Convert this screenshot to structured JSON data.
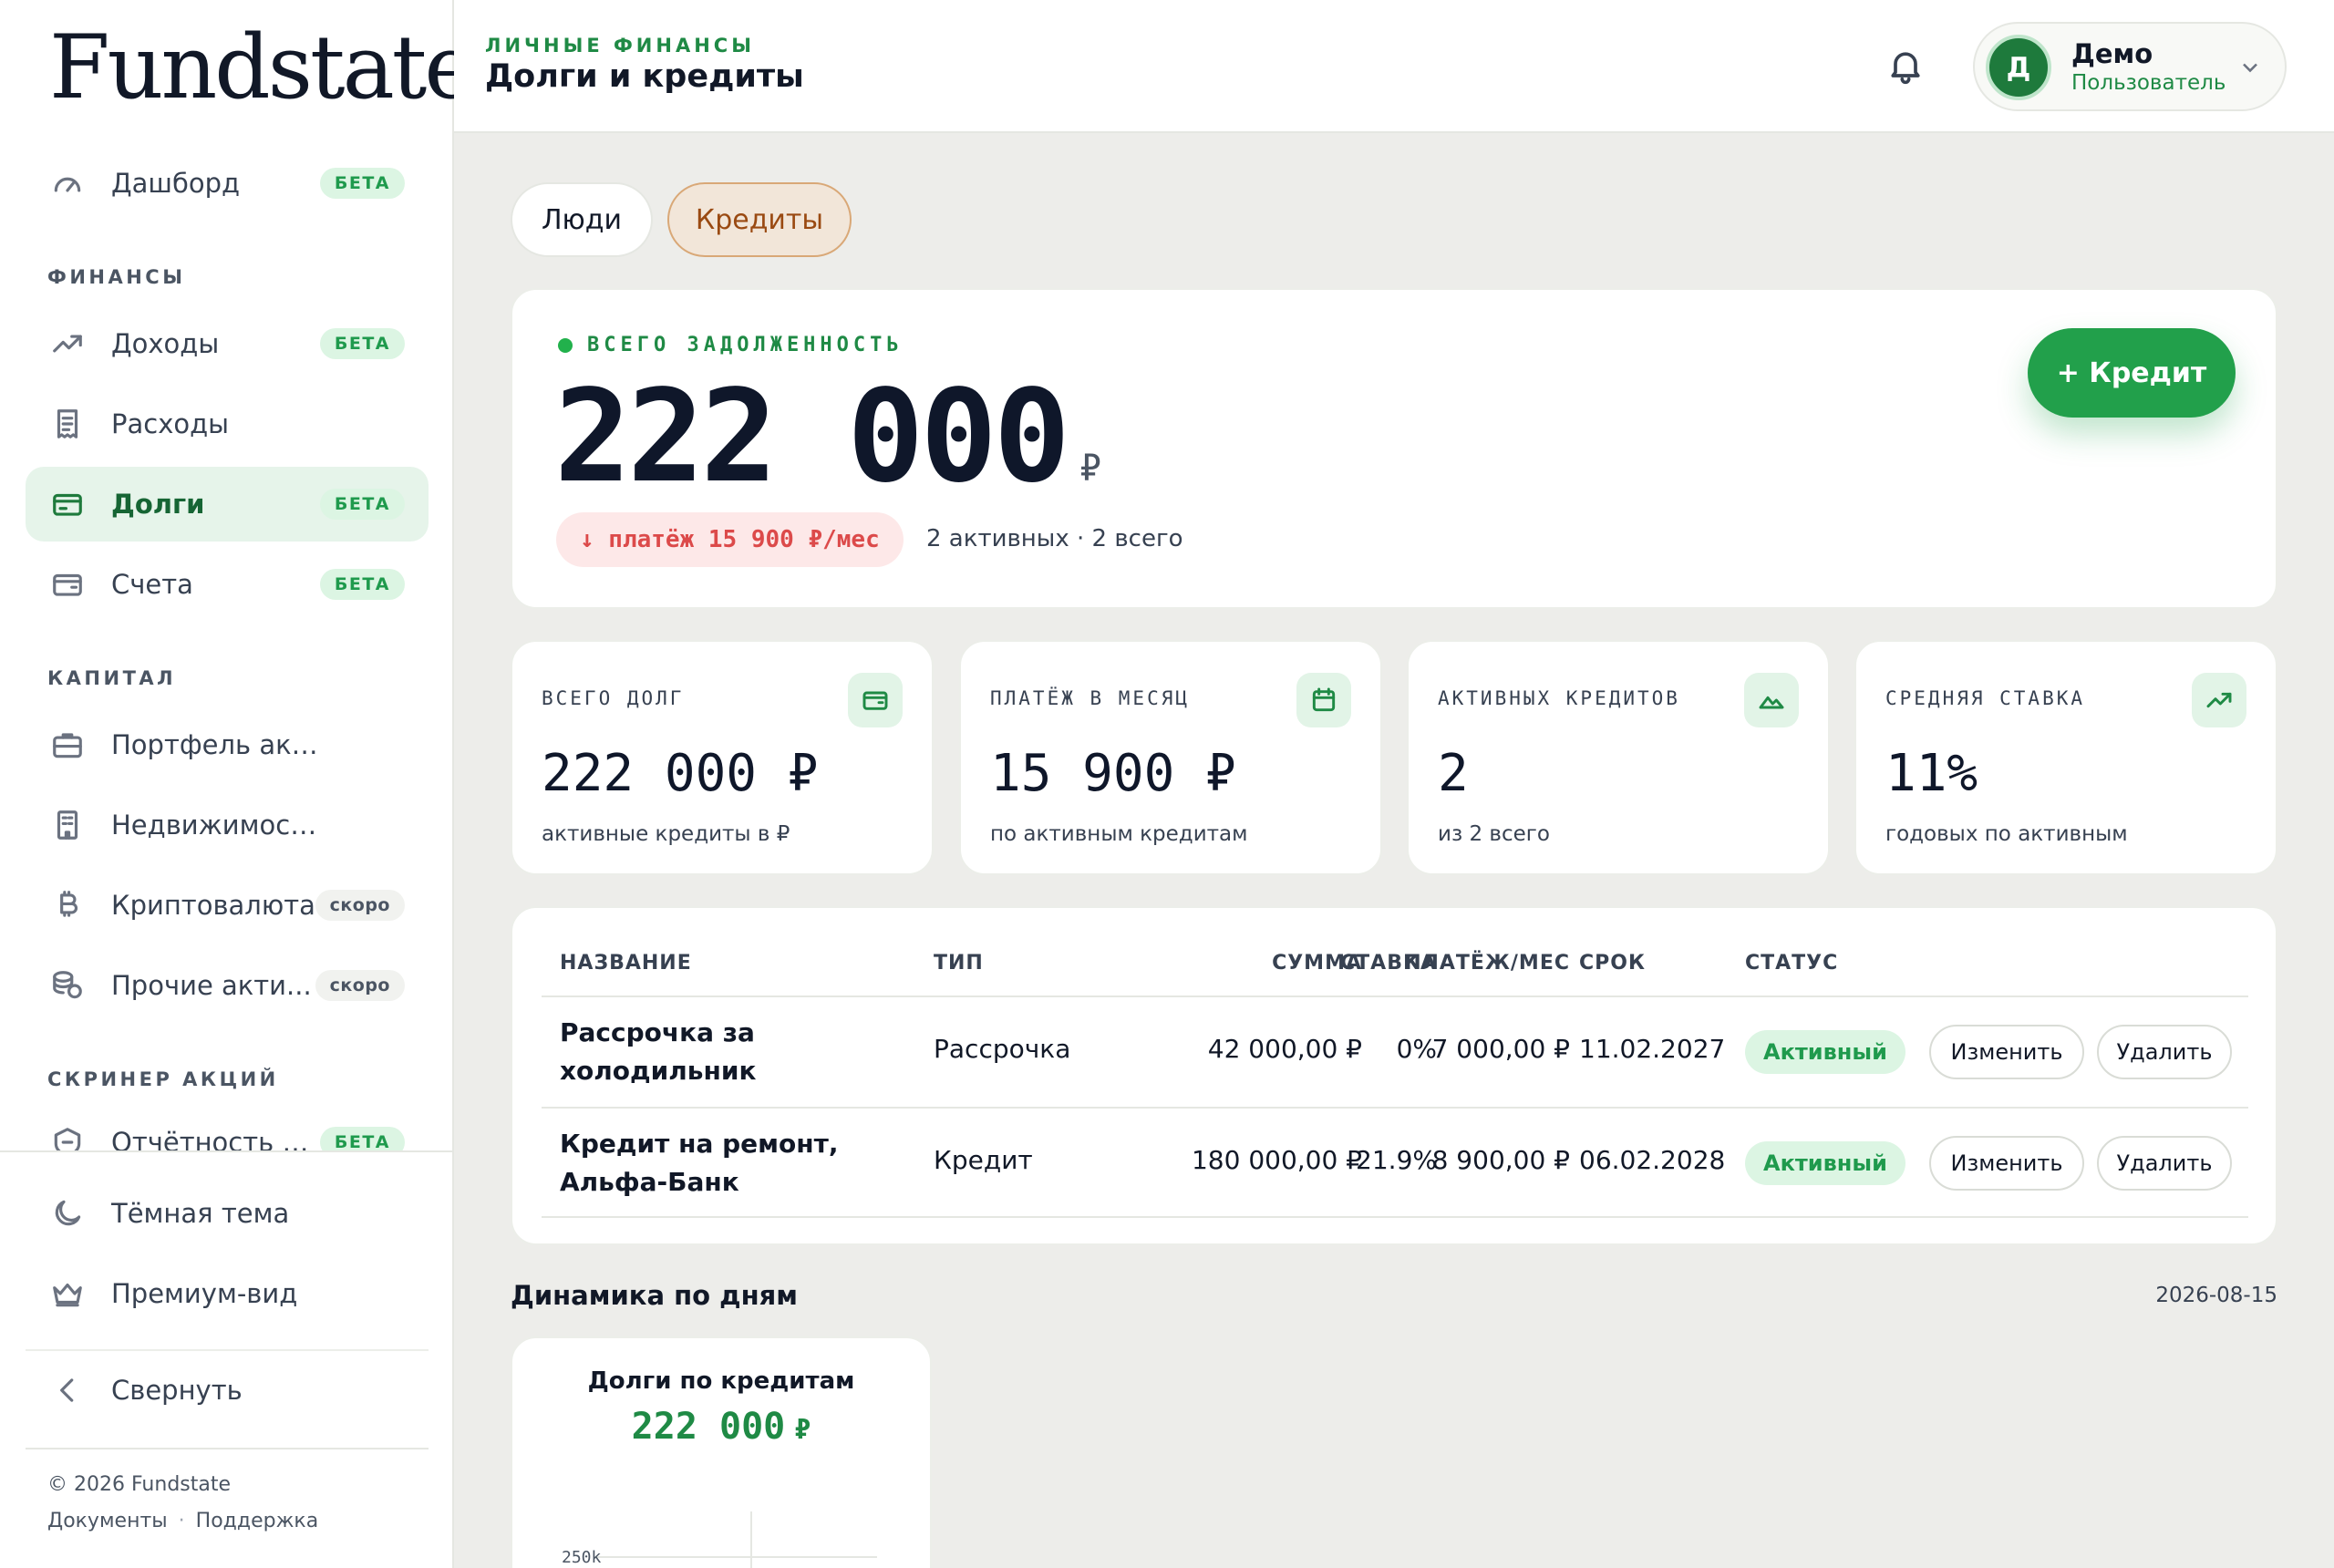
{
  "sidebar": {
    "logo": "Fundstate",
    "dashboard": {
      "label": "Дашборд",
      "badge": "БЕТА"
    },
    "section_finance": "ФИНАНСЫ",
    "income": {
      "label": "Доходы",
      "badge": "БЕТА"
    },
    "expenses": {
      "label": "Расходы"
    },
    "debts": {
      "label": "Долги",
      "badge": "БЕТА"
    },
    "accounts": {
      "label": "Счета",
      "badge": "БЕТА"
    },
    "section_capital": "КАПИТАЛ",
    "stocks": {
      "label": "Портфель акций"
    },
    "realty": {
      "label": "Недвижимость"
    },
    "crypto": {
      "label": "Криптовалюта",
      "badge": "скоро"
    },
    "other": {
      "label": "Прочие акти...",
      "badge": "скоро"
    },
    "section_screener": "СКРИНЕР АКЦИЙ",
    "reports": {
      "label": "Отчётность ко...",
      "badge": "БЕТА"
    },
    "dark_theme": "Тёмная тема",
    "premium": "Премиум-вид",
    "collapse": "Свернуть",
    "copyright": "© 2026 Fundstate",
    "docs": "Документы",
    "sep": "·",
    "support": "Поддержка"
  },
  "header": {
    "eyebrow": "ЛИЧНЫЕ ФИНАНСЫ",
    "title": "Долги и кредиты",
    "user_initial": "Д",
    "user_name": "Демо",
    "user_role": "Пользователь"
  },
  "tabs": {
    "people": "Люди",
    "credits": "Кредиты"
  },
  "hero": {
    "label": "ВСЕГО ЗАДОЛЖЕННОСТЬ",
    "amount": "222 000",
    "currency": "₽",
    "payment": "↓ платёж 15 900 ₽/мес",
    "meta": "2 активных · 2 всего",
    "add_button": "+ Кредит"
  },
  "stats": [
    {
      "label": "ВСЕГО ДОЛГ",
      "value": "222 000 ₽",
      "sub": "активные кредиты в ₽",
      "icon": "wallet-icon"
    },
    {
      "label": "ПЛАТЁЖ В МЕСЯЦ",
      "value": "15 900 ₽",
      "sub": "по активным кредитам",
      "icon": "calendar-icon"
    },
    {
      "label": "АКТИВНЫХ КРЕДИТОВ",
      "value": "2",
      "sub": "из 2 всего",
      "icon": "mountain-icon"
    },
    {
      "label": "СРЕДНЯЯ СТАВКА",
      "value": "11%",
      "sub": "годовых по активным",
      "icon": "trend-up-icon"
    }
  ],
  "table": {
    "headers": {
      "name": "НАЗВАНИЕ",
      "type": "ТИП",
      "amount": "СУММА",
      "rate": "СТАВКА",
      "payment": "ПЛАТЁЖ/МЕС",
      "term": "СРОК",
      "status": "СТАТУС"
    },
    "rows": [
      {
        "name": "Рассрочка за холодильник",
        "type": "Рассрочка",
        "amount": "42 000,00 ₽",
        "rate": "0%",
        "payment": "7 000,00 ₽",
        "term": "11.02.2027",
        "status": "Активный",
        "edit": "Изменить",
        "delete": "Удалить"
      },
      {
        "name": "Кредит на ремонт, Альфа-Банк",
        "type": "Кредит",
        "amount": "180 000,00 ₽",
        "rate": "21.9%",
        "payment": "8 900,00 ₽",
        "term": "06.02.2028",
        "status": "Активный",
        "edit": "Изменить",
        "delete": "Удалить"
      }
    ]
  },
  "dynamics": {
    "title": "Динамика по дням",
    "date": "2026-08-15",
    "mini_title": "Долги по кредитам",
    "mini_amount": "222 000",
    "mini_currency": "₽",
    "axis_label": "250k"
  },
  "colors": {
    "accent": "#22a04b",
    "brand_dark": "#1e7a3c",
    "danger": "#dc4a4a",
    "credits_tab": "#f2e6d9"
  }
}
